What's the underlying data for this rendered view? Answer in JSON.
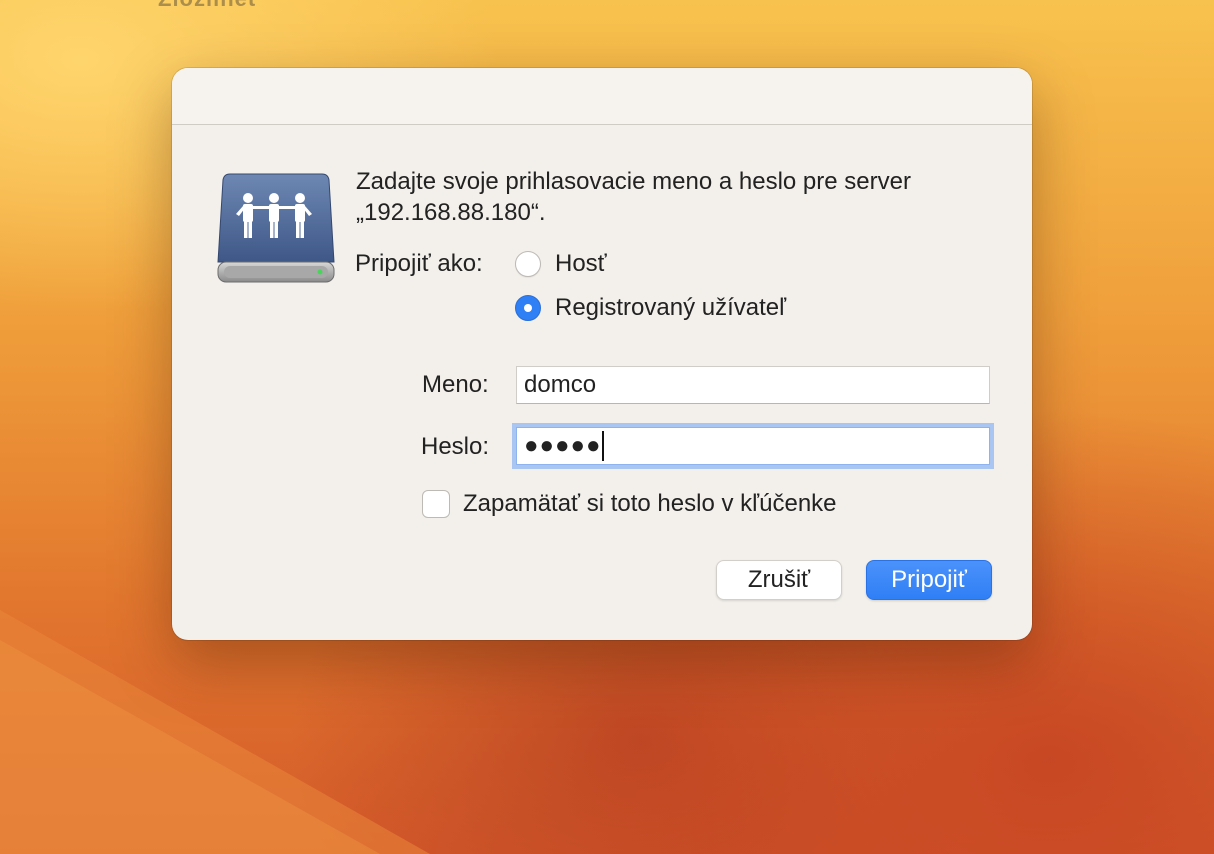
{
  "desktop": {
    "partial_label": "Zložlinět"
  },
  "dialog": {
    "prompt_line1": "Zadajte svoje prihlasovacie meno a heslo pre server",
    "prompt_line2": "„192.168.88.180“.",
    "connect_as_label": "Pripojiť ako:",
    "options": [
      {
        "label": "Hosť",
        "selected": false
      },
      {
        "label": "Registrovaný užívateľ",
        "selected": true
      }
    ],
    "name_label": "Meno:",
    "name_value": "domco",
    "password_label": "Heslo:",
    "password_masked": "●●●●●",
    "remember_label": "Zapamätať si toto heslo v kľúčenke",
    "remember_checked": false,
    "cancel_label": "Zrušiť",
    "connect_label": "Pripojiť"
  },
  "colors": {
    "accent": "#2f7ff5",
    "dialog_bg": "#f3f0eb",
    "focus_ring": "#a9c6f3"
  },
  "icons": {
    "server": "shared-server-icon"
  }
}
